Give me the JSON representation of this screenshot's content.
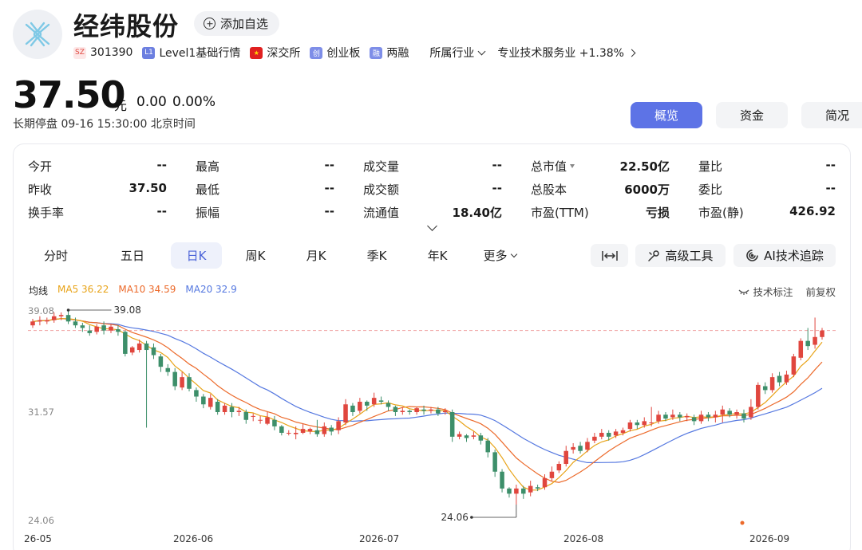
{
  "header": {
    "name": "经纬股份",
    "watch_label": "添加自选",
    "code_badge": "SZ",
    "code": "301390",
    "l1_badge": "L1",
    "level": "Level1基础行情",
    "exchange": "深交所",
    "board_badge": "创",
    "board": "创业板",
    "margin_badge": "融",
    "margin": "两融",
    "industry_label": "所属行业",
    "industry_value": "专业技术服务业 +1.38%"
  },
  "price": {
    "value": "37.50",
    "unit": "元",
    "change": "0.00",
    "change_pct": "0.00%",
    "status": "长期停盘  09-16 15:30:00  北京时间"
  },
  "top_tabs": [
    {
      "label": "概览",
      "active": true
    },
    {
      "label": "资金",
      "active": false
    },
    {
      "label": "简况",
      "active": false
    }
  ],
  "quote": [
    [
      [
        "今开",
        "--"
      ],
      [
        "最高",
        "--"
      ],
      [
        "成交量",
        "--"
      ],
      [
        "总市值",
        "22.50亿"
      ],
      [
        "量比",
        "--"
      ]
    ],
    [
      [
        "昨收",
        "37.50"
      ],
      [
        "最低",
        "--"
      ],
      [
        "成交额",
        "--"
      ],
      [
        "总股本",
        "6000万"
      ],
      [
        "委比",
        "--"
      ]
    ],
    [
      [
        "换手率",
        "--"
      ],
      [
        "振幅",
        "--"
      ],
      [
        "流通值",
        "18.40亿"
      ],
      [
        "市盈(TTM)",
        "亏损"
      ],
      [
        "市盈(静)",
        "426.92"
      ]
    ]
  ],
  "period_tabs": [
    {
      "label": "分时",
      "active": false
    },
    {
      "label": "五日",
      "active": false
    },
    {
      "label": "日K",
      "active": true
    },
    {
      "label": "周K",
      "active": false
    },
    {
      "label": "月K",
      "active": false
    },
    {
      "label": "季K",
      "active": false
    },
    {
      "label": "年K",
      "active": false
    },
    {
      "label": "更多",
      "active": false
    }
  ],
  "tools": {
    "advanced": "高级工具",
    "ai": "AI技术追踪"
  },
  "ma": {
    "label": "均线",
    "ma5": "MA5 36.22",
    "ma10": "MA10 34.59",
    "ma20": "MA20 32.9",
    "mark_label": "技术标注",
    "adjust_label": "前复权"
  },
  "colors": {
    "up": "#e0463e",
    "down": "#3d8f6a",
    "ma5": "#e8a317",
    "ma10": "#ec6a2b",
    "ma20": "#5578e0",
    "accent": "#5d73e6"
  },
  "chart_data": {
    "type": "candlestick",
    "ylim": [
      24.06,
      39.08
    ],
    "y_ticks": [
      "39.08",
      "31.57",
      "24.06"
    ],
    "x_ticks": [
      "26-05",
      "2026-06",
      "2026-07",
      "2026-08",
      "2026-09"
    ],
    "high_marker": "39.08",
    "low_marker": "24.06",
    "last_close": 37.5,
    "candles": [
      [
        37.9,
        38.2,
        37.7,
        38.4
      ],
      [
        38.2,
        38.3,
        37.9,
        38.6
      ],
      [
        38.2,
        38.3,
        38.0,
        38.5
      ],
      [
        38.3,
        38.6,
        38.1,
        38.9
      ],
      [
        38.6,
        38.7,
        38.3,
        38.9
      ],
      [
        38.7,
        38.2,
        38.0,
        39.08
      ],
      [
        38.2,
        37.9,
        37.7,
        38.5
      ],
      [
        37.9,
        37.7,
        37.4,
        38.1
      ],
      [
        37.5,
        37.3,
        37.1,
        37.9
      ],
      [
        37.4,
        37.8,
        37.2,
        38.0
      ],
      [
        37.9,
        37.5,
        37.2,
        38.2
      ],
      [
        37.5,
        37.8,
        37.3,
        38.0
      ],
      [
        37.6,
        37.4,
        37.1,
        37.9
      ],
      [
        37.4,
        35.7,
        35.5,
        37.5
      ],
      [
        35.8,
        36.2,
        35.6,
        36.3
      ],
      [
        36.0,
        36.5,
        35.8,
        36.8
      ],
      [
        36.5,
        36.0,
        30.0,
        36.7
      ],
      [
        36.2,
        35.6,
        35.3,
        36.5
      ],
      [
        35.5,
        34.7,
        34.3,
        35.7
      ],
      [
        34.6,
        34.3,
        34.0,
        34.9
      ],
      [
        34.3,
        33.2,
        32.9,
        34.6
      ],
      [
        33.1,
        33.9,
        32.9,
        34.3
      ],
      [
        33.9,
        33.0,
        32.8,
        34.2
      ],
      [
        32.9,
        32.4,
        32.0,
        33.1
      ],
      [
        32.4,
        31.8,
        31.5,
        32.6
      ],
      [
        31.6,
        32.3,
        31.4,
        32.6
      ],
      [
        32.0,
        31.2,
        31.0,
        32.2
      ],
      [
        31.2,
        31.7,
        31.0,
        31.9
      ],
      [
        31.6,
        31.2,
        30.8,
        31.9
      ],
      [
        31.2,
        31.3,
        30.9,
        31.6
      ],
      [
        31.2,
        30.6,
        30.3,
        31.4
      ],
      [
        30.9,
        30.9,
        30.5,
        31.1
      ],
      [
        30.6,
        30.6,
        30.3,
        30.9
      ],
      [
        30.3,
        30.8,
        30.2,
        31.2
      ],
      [
        30.6,
        30.1,
        29.8,
        30.9
      ],
      [
        30.1,
        29.6,
        29.4,
        30.2
      ],
      [
        29.6,
        29.6,
        29.4,
        29.8
      ],
      [
        29.5,
        29.6,
        29.1,
        30.1
      ],
      [
        29.6,
        29.9,
        29.5,
        30.3
      ],
      [
        29.7,
        29.9,
        29.5,
        30.0
      ],
      [
        29.8,
        29.5,
        29.3,
        30.6
      ],
      [
        29.5,
        30.1,
        29.3,
        30.4
      ],
      [
        30.0,
        29.7,
        29.4,
        30.2
      ],
      [
        29.8,
        30.5,
        29.5,
        30.8
      ],
      [
        30.4,
        31.8,
        30.2,
        32.2
      ],
      [
        31.7,
        31.2,
        30.9,
        31.9
      ],
      [
        31.3,
        32.0,
        31.1,
        32.3
      ],
      [
        32.0,
        31.7,
        31.3,
        32.1
      ],
      [
        31.8,
        32.3,
        31.6,
        32.7
      ],
      [
        32.1,
        32.0,
        31.8,
        32.4
      ],
      [
        31.9,
        31.6,
        31.3,
        32.1
      ],
      [
        31.6,
        31.2,
        30.9,
        31.7
      ],
      [
        31.2,
        31.3,
        31.0,
        31.6
      ],
      [
        31.3,
        31.2,
        31.0,
        31.4
      ],
      [
        31.2,
        31.5,
        31.0,
        31.6
      ],
      [
        31.4,
        31.3,
        31.0,
        31.7
      ],
      [
        31.3,
        31.4,
        31.1,
        31.6
      ],
      [
        31.4,
        31.1,
        30.9,
        31.6
      ],
      [
        31.2,
        31.3,
        31.0,
        31.5
      ],
      [
        31.2,
        29.3,
        28.9,
        31.4
      ],
      [
        29.3,
        29.5,
        29.1,
        29.7
      ],
      [
        29.4,
        29.2,
        28.9,
        29.5
      ],
      [
        29.3,
        29.4,
        29.1,
        29.7
      ],
      [
        29.4,
        29.0,
        28.7,
        29.6
      ],
      [
        29.0,
        28.1,
        27.7,
        29.2
      ],
      [
        28.1,
        26.6,
        26.2,
        28.3
      ],
      [
        26.6,
        25.3,
        25.0,
        26.8
      ],
      [
        25.3,
        24.9,
        24.6,
        25.4
      ],
      [
        24.9,
        25.3,
        24.06,
        25.6
      ],
      [
        25.3,
        24.9,
        24.5,
        25.5
      ],
      [
        25.0,
        25.5,
        24.7,
        25.9
      ],
      [
        25.4,
        25.3,
        25.1,
        25.6
      ],
      [
        25.4,
        26.1,
        25.2,
        26.4
      ],
      [
        26.1,
        26.6,
        25.9,
        27.0
      ],
      [
        26.7,
        27.2,
        26.5,
        27.4
      ],
      [
        27.2,
        28.2,
        27.0,
        28.6
      ],
      [
        28.3,
        28.5,
        28.0,
        28.8
      ],
      [
        28.6,
        28.2,
        28.0,
        28.9
      ],
      [
        28.3,
        28.9,
        28.1,
        29.2
      ],
      [
        29.0,
        29.3,
        28.8,
        29.6
      ],
      [
        29.3,
        29.6,
        29.1,
        29.9
      ],
      [
        29.6,
        29.3,
        29.0,
        29.8
      ],
      [
        29.4,
        29.7,
        29.2,
        29.9
      ],
      [
        29.6,
        29.8,
        29.4,
        30.0
      ],
      [
        29.9,
        30.4,
        29.7,
        30.6
      ],
      [
        30.4,
        30.2,
        29.9,
        30.6
      ],
      [
        30.2,
        30.5,
        30.0,
        30.8
      ],
      [
        30.4,
        30.4,
        30.1,
        31.6
      ],
      [
        30.5,
        31.0,
        30.3,
        31.3
      ],
      [
        31.0,
        30.7,
        30.5,
        31.2
      ],
      [
        30.8,
        31.0,
        30.6,
        31.4
      ],
      [
        31.0,
        30.8,
        30.5,
        31.2
      ],
      [
        30.8,
        30.9,
        30.5,
        31.1
      ],
      [
        30.8,
        30.5,
        30.2,
        31.0
      ],
      [
        30.5,
        31.0,
        30.3,
        31.3
      ],
      [
        31.0,
        30.8,
        30.5,
        31.2
      ],
      [
        30.8,
        31.0,
        30.4,
        31.3
      ],
      [
        31.0,
        31.4,
        30.4,
        31.7
      ],
      [
        31.3,
        31.0,
        30.8,
        31.5
      ],
      [
        31.0,
        31.2,
        30.7,
        31.4
      ],
      [
        31.1,
        30.7,
        30.4,
        31.4
      ],
      [
        30.8,
        31.6,
        30.6,
        32.2
      ],
      [
        31.6,
        33.3,
        31.4,
        33.5
      ],
      [
        33.2,
        32.9,
        32.6,
        33.5
      ],
      [
        32.9,
        33.9,
        32.7,
        34.2
      ],
      [
        34.0,
        33.5,
        33.2,
        34.3
      ],
      [
        33.5,
        34.1,
        33.3,
        34.4
      ],
      [
        34.1,
        35.5,
        33.9,
        35.7
      ],
      [
        35.4,
        36.7,
        35.2,
        36.9
      ],
      [
        36.7,
        36.3,
        36.0,
        37.7
      ],
      [
        36.4,
        37.0,
        36.1,
        38.5
      ],
      [
        37.0,
        37.5,
        36.8,
        37.7
      ]
    ]
  }
}
